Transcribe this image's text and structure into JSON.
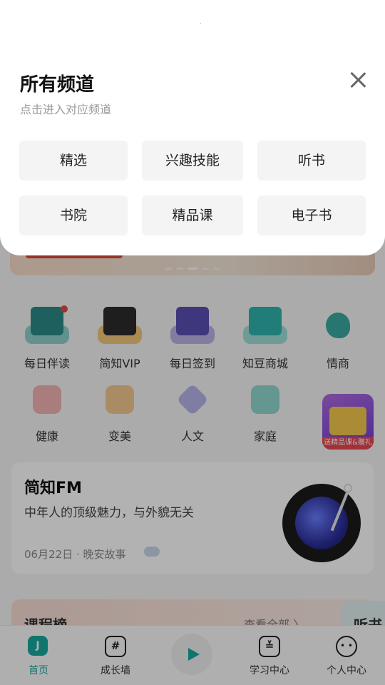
{
  "modal": {
    "title": "所有频道",
    "subtitle": "点击进入对应频道",
    "channels": [
      "精选",
      "兴趣技能",
      "听书",
      "书院",
      "精品课",
      "电子书"
    ]
  },
  "grid": {
    "row1": [
      "每日伴读",
      "简知VIP",
      "每日签到",
      "知豆商城",
      "情商"
    ],
    "row2": [
      "健康",
      "变美",
      "人文",
      "家庭"
    ]
  },
  "promo": {
    "tag": "送精品课&赠礼"
  },
  "fm": {
    "title": "简知FM",
    "subtitle": "中年人的顶级魅力，与外貌无关",
    "meta": "06月22日 · 晚安故事"
  },
  "course": {
    "title": "课程榜",
    "more": "查看全部 〉",
    "side": "听书"
  },
  "tabs": {
    "home": "首页",
    "growth": "成长墙",
    "learn": "学习中心",
    "me": "个人中心",
    "home_icon": "J",
    "growth_icon": "#",
    "learn_icon": "≚",
    "me_icon": "• •"
  },
  "colors": {
    "accent": "#19a89f",
    "banner_red": "#d84a3c"
  }
}
